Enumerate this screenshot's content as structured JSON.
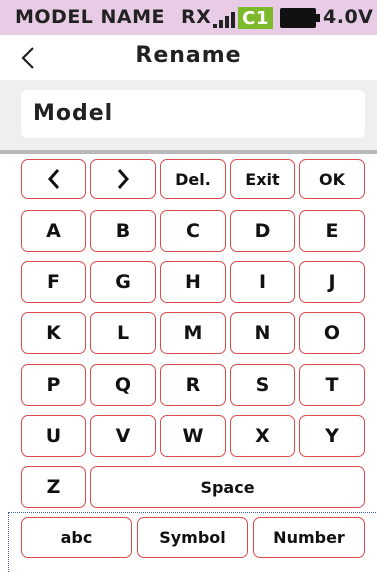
{
  "status_bar": {
    "model_name": "MODEL NAME",
    "rx_label": "RX",
    "channel_badge": "C1",
    "voltage": "4.0V",
    "background_color": "#e8cce6",
    "badge_color": "#7cba2c"
  },
  "header": {
    "back_icon": "chevron-left-icon",
    "title": "Rename"
  },
  "name_field": {
    "value": "Model"
  },
  "keyboard": {
    "control_row": {
      "left_icon": "chevron-left-icon",
      "right_icon": "chevron-right-icon",
      "delete_label": "Del.",
      "exit_label": "Exit",
      "ok_label": "OK"
    },
    "letters": [
      "A",
      "B",
      "C",
      "D",
      "E",
      "F",
      "G",
      "H",
      "I",
      "J",
      "K",
      "L",
      "M",
      "N",
      "O",
      "P",
      "Q",
      "R",
      "S",
      "T",
      "U",
      "V",
      "W",
      "X",
      "Y",
      "Z"
    ],
    "space_label": "Space",
    "mode_buttons": {
      "lowercase": "abc",
      "symbol": "Symbol",
      "number": "Number"
    },
    "key_border_color": "#d94a4a"
  }
}
